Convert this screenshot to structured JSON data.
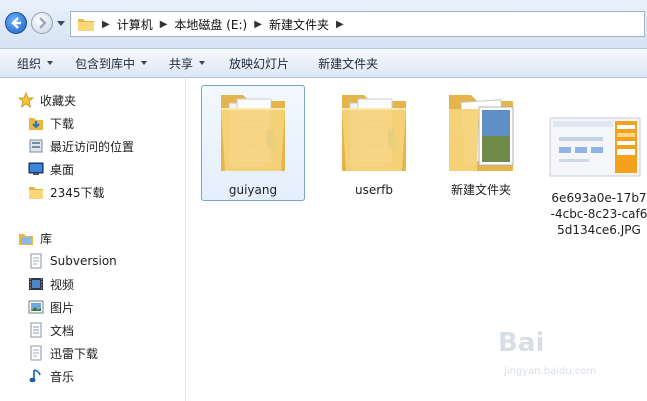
{
  "breadcrumb": {
    "items": [
      "计算机",
      "本地磁盘 (E:)",
      "新建文件夹"
    ]
  },
  "toolbar": {
    "organize": "组织",
    "include_in_library": "包含到库中",
    "share": "共享",
    "slideshow": "放映幻灯片",
    "new_folder": "新建文件夹"
  },
  "navpane": {
    "favorites_header": "收藏夹",
    "favorites": [
      "下载",
      "最近访问的位置",
      "桌面",
      "2345下载"
    ],
    "libraries_header": "库",
    "libraries": [
      "Subversion",
      "视频",
      "图片",
      "文档",
      "迅雷下载",
      "音乐"
    ]
  },
  "files": [
    {
      "name": "guiyang",
      "kind": "folder"
    },
    {
      "name": "userfb",
      "kind": "folder"
    },
    {
      "name": "新建文件夹",
      "kind": "folder-images"
    },
    {
      "name_lines": [
        "6e693a0e-17b7",
        "-4cbc-8c23-caf6",
        "5d134ce6.JPG"
      ],
      "kind": "image"
    }
  ],
  "watermark": {
    "text": "Bai",
    "sub": "jingyan.baidu.com"
  },
  "colors": {
    "accent": "#1b5fc4",
    "folder": "#f2c868",
    "selection": "#7da2ce"
  }
}
